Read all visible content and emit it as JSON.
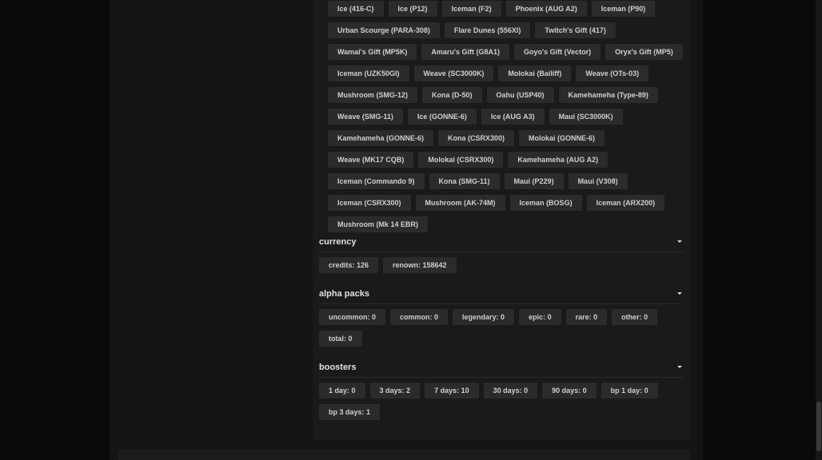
{
  "weapons": {
    "top_partial_count": 4,
    "chips": [
      "Ice (416-C)",
      "Ice (P12)",
      "Iceman (F2)",
      "Phoenix (AUG A2)",
      "Iceman (P90)",
      "Urban Scourge (PARA-308)",
      "Flare Dunes (556XI)",
      "Twitch's Gift (417)",
      "Wamai's Gift (MP5K)",
      "Amaru's Gift (G8A1)",
      "Goyo's Gift (Vector)",
      "Oryx's Gift (MP5)",
      "Iceman (UZK50GI)",
      "Weave (SC3000K)",
      "Molokai (Bailiff)",
      "Weave (OTs-03)",
      "Mushroom (SMG-12)",
      "Kona (D-50)",
      "Oahu (USP40)",
      "Kamehameha (Type-89)",
      "Weave (SMG-11)",
      "Ice (GONNE-6)",
      "Ice (AUG A3)",
      "Maui (SC3000K)",
      "Kamehameha (GONNE-6)",
      "Kona (CSRX300)",
      "Molokai (GONNE-6)",
      "Weave (MK17 CQB)",
      "Molokai (CSRX300)",
      "Kamehameha (AUG A2)",
      "Iceman (Commando 9)",
      "Kona (SMG-11)",
      "Maui (P229)",
      "Maui (V308)",
      "Iceman (CSRX300)",
      "Mushroom (AK-74M)",
      "Iceman (BOSG)",
      "Iceman (ARX200)",
      "Mushroom (Mk 14 EBR)"
    ]
  },
  "currency": {
    "title": "currency",
    "chips": [
      "credits: 126",
      "renown: 158642"
    ]
  },
  "alpha_packs": {
    "title": "alpha packs",
    "chips": [
      "uncommon: 0",
      "common: 0",
      "legendary: 0",
      "epic: 0",
      "rare: 0",
      "other: 0",
      "total: 0"
    ]
  },
  "boosters": {
    "title": "boosters",
    "chips": [
      "1 day: 0",
      "3 days: 2",
      "7 days: 10",
      "30 days: 0",
      "90 days: 0",
      "bp 1 day: 0",
      "bp 3 days: 1"
    ]
  },
  "icons": {
    "section_toggle": "caret-down-icon"
  }
}
